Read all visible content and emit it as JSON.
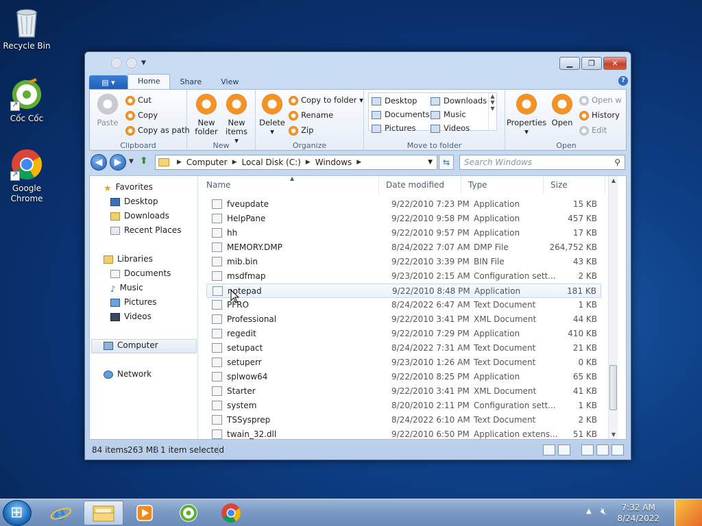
{
  "desktop": {
    "icons": [
      {
        "label": "Recycle Bin"
      },
      {
        "label": "Cốc Cốc"
      },
      {
        "label": "Google Chrome"
      }
    ]
  },
  "ribbon": {
    "tabs": {
      "home": "Home",
      "share": "Share",
      "view": "View"
    },
    "clipboard": {
      "label": "Clipboard",
      "paste": "Paste",
      "cut": "Cut",
      "copy": "Copy",
      "copy_as_path": "Copy as path"
    },
    "new": {
      "label": "New",
      "new_folder_1": "New",
      "new_folder_2": "folder",
      "new_items_1": "New",
      "new_items_2": "items ▾"
    },
    "organize": {
      "label": "Organize",
      "delete": "Delete",
      "copy_to_folder": "Copy to folder ▾",
      "rename": "Rename",
      "zip": "Zip"
    },
    "move_to_folder": {
      "label": "Move to folder",
      "items": [
        "Desktop",
        "Documents",
        "Pictures",
        "Downloads",
        "Music",
        "Videos"
      ]
    },
    "open": {
      "label": "Open",
      "properties": "Properties",
      "open": "Open",
      "open_with": "Open w",
      "history": "History",
      "edit": "Edit"
    }
  },
  "address": {
    "crumbs": [
      "Computer",
      "Local Disk (C:)",
      "Windows"
    ],
    "search_placeholder": "Search Windows"
  },
  "navpane": {
    "favorites": "Favorites",
    "fav_items": [
      "Desktop",
      "Downloads",
      "Recent Places"
    ],
    "libraries": "Libraries",
    "lib_items": [
      "Documents",
      "Music",
      "Pictures",
      "Videos"
    ],
    "computer": "Computer",
    "network": "Network"
  },
  "columns": {
    "name": "Name",
    "date": "Date modified",
    "type": "Type",
    "size": "Size"
  },
  "files": [
    {
      "name": "fveupdate",
      "date": "9/22/2010 7:23 PM",
      "type": "Application",
      "size": "15 KB"
    },
    {
      "name": "HelpPane",
      "date": "9/22/2010 9:58 PM",
      "type": "Application",
      "size": "457 KB"
    },
    {
      "name": "hh",
      "date": "9/22/2010 9:57 PM",
      "type": "Application",
      "size": "17 KB"
    },
    {
      "name": "MEMORY.DMP",
      "date": "8/24/2022 7:07 AM",
      "type": "DMP File",
      "size": "264,752 KB"
    },
    {
      "name": "mib.bin",
      "date": "9/22/2010 3:39 PM",
      "type": "BIN File",
      "size": "43 KB"
    },
    {
      "name": "msdfmap",
      "date": "9/23/2010 2:15 AM",
      "type": "Configuration sett...",
      "size": "2 KB"
    },
    {
      "name": "notepad",
      "date": "9/22/2010 8:48 PM",
      "type": "Application",
      "size": "181 KB"
    },
    {
      "name": "PFRO",
      "date": "8/24/2022 6:47 AM",
      "type": "Text Document",
      "size": "1 KB"
    },
    {
      "name": "Professional",
      "date": "9/22/2010 3:41 PM",
      "type": "XML Document",
      "size": "44 KB"
    },
    {
      "name": "regedit",
      "date": "9/22/2010 7:29 PM",
      "type": "Application",
      "size": "410 KB"
    },
    {
      "name": "setupact",
      "date": "8/24/2022 7:31 AM",
      "type": "Text Document",
      "size": "21 KB"
    },
    {
      "name": "setuperr",
      "date": "9/23/2010 1:26 AM",
      "type": "Text Document",
      "size": "0 KB"
    },
    {
      "name": "splwow64",
      "date": "9/22/2010 8:25 PM",
      "type": "Application",
      "size": "65 KB"
    },
    {
      "name": "Starter",
      "date": "9/22/2010 3:41 PM",
      "type": "XML Document",
      "size": "41 KB"
    },
    {
      "name": "system",
      "date": "8/20/2010 2:11 PM",
      "type": "Configuration sett...",
      "size": "1 KB"
    },
    {
      "name": "TSSysprep",
      "date": "8/24/2022 6:10 AM",
      "type": "Text Document",
      "size": "2 KB"
    },
    {
      "name": "twain_32.dll",
      "date": "9/22/2010 6:50 PM",
      "type": "Application extens...",
      "size": "51 KB"
    }
  ],
  "status": {
    "items": "84 items",
    "size": "263 MB",
    "selected": "1 item selected"
  },
  "taskbar": {
    "time": "7:32 AM",
    "date": "8/24/2022"
  }
}
